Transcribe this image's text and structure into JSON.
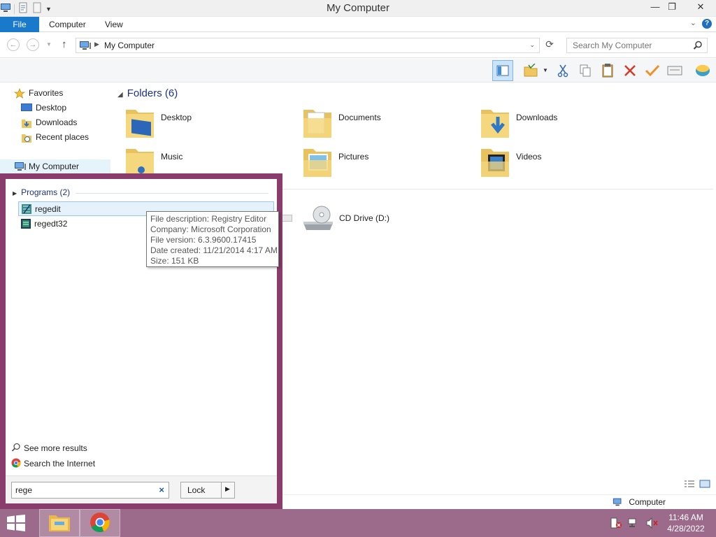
{
  "window": {
    "title": "My Computer",
    "controls": {
      "minimize": "—",
      "restore": "❐",
      "close": "✕"
    }
  },
  "ribbon": {
    "tabs": [
      "File",
      "Computer",
      "View"
    ],
    "help": "?"
  },
  "address_bar": {
    "path": "My Computer",
    "search_placeholder": "Search My Computer"
  },
  "toolbar": {
    "icons": [
      "preview-pane-icon",
      "folder-options-icon",
      "cut-icon",
      "copy-icon",
      "paste-icon",
      "delete-icon",
      "check-icon",
      "properties-icon",
      "network-icon"
    ]
  },
  "nav_pane": {
    "favorites_label": "Favorites",
    "favorites": [
      "Desktop",
      "Downloads",
      "Recent places"
    ],
    "computer_label": "My Computer"
  },
  "content": {
    "group_header": "Folders (6)",
    "folders": [
      "Desktop",
      "Documents",
      "Downloads",
      "Music",
      "Pictures",
      "Videos"
    ],
    "drive_label": "CD Drive (D:)"
  },
  "status_bar": {
    "computer_label": "Computer"
  },
  "start_search": {
    "group_header": "Programs (2)",
    "results": [
      "regedit",
      "regedt32"
    ],
    "see_more": "See more results",
    "search_internet": "Search the Internet",
    "query": "rege",
    "lock_button": "Lock"
  },
  "tooltip": {
    "lines": [
      "File description: Registry Editor",
      "Company: Microsoft Corporation",
      "File version: 6.3.9600.17415",
      "Date created: 11/21/2014 4:17 AM",
      "Size: 151 KB"
    ]
  },
  "taskbar": {
    "time": "11:46 AM",
    "date": "4/28/2022",
    "color": "#9c6b8b"
  },
  "colors": {
    "accent": "#1979ca",
    "start_panel_border": "#8a3d6d"
  }
}
